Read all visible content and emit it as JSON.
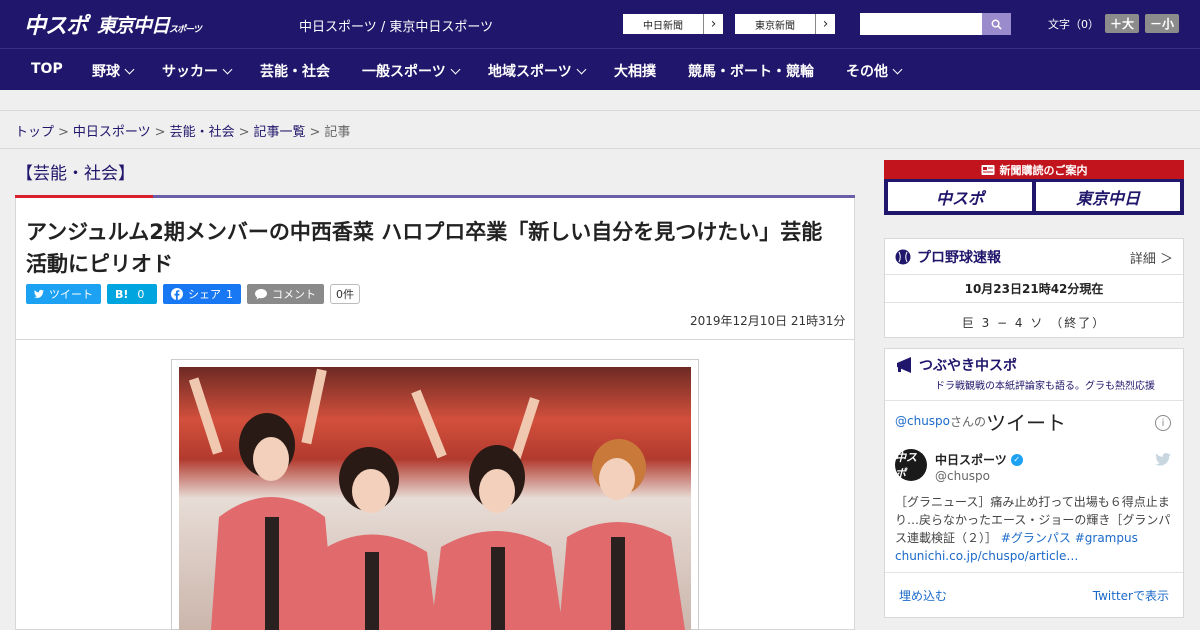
{
  "header": {
    "logo_chuspo": "中スポ",
    "logo_tokyo": "東京中日",
    "logo_tokyo_small": "スポーツ",
    "site_names": "中日スポーツ / 東京中日スポーツ",
    "papers": [
      {
        "label": "中日新聞"
      },
      {
        "label": "東京新聞"
      }
    ],
    "font_size_label": "文字（0）",
    "font_larger": "＋大",
    "font_smaller": "－小"
  },
  "nav": {
    "items": [
      {
        "label": "TOP",
        "has_menu": false
      },
      {
        "label": "野球",
        "has_menu": true
      },
      {
        "label": "サッカー",
        "has_menu": true
      },
      {
        "label": "芸能・社会",
        "has_menu": false
      },
      {
        "label": "一般スポーツ",
        "has_menu": true
      },
      {
        "label": "地域スポーツ",
        "has_menu": true
      },
      {
        "label": "大相撲",
        "has_menu": false
      },
      {
        "label": "競馬・ボート・競輪",
        "has_menu": false
      },
      {
        "label": "その他",
        "has_menu": true
      }
    ]
  },
  "breadcrumb": {
    "items": [
      "トップ",
      "中日スポーツ",
      "芸能・社会",
      "記事一覧"
    ],
    "current": "記事",
    "separator": ">"
  },
  "article": {
    "section": "【芸能・社会】",
    "headline": "アンジュルム2期メンバーの中西香菜 ハロプロ卒業「新しい自分を見つけたい」芸能活動にピリオド",
    "share": {
      "tweet": "ツイート",
      "hatena_icon": "B!",
      "hatena_count": "0",
      "facebook": "シェア",
      "facebook_count": "1",
      "comment": "コメント",
      "comment_count": "0件"
    },
    "date": "2019年12月10日 21時31分"
  },
  "sidebar": {
    "subscribe": {
      "title": "新聞購読のご案内",
      "left": "中スポ",
      "right": "東京中日"
    },
    "baseball": {
      "title": "プロ野球速報",
      "detail": "詳細 ＞",
      "updated": "10月23日21時42分現在",
      "score": "巨 3 − 4 ソ （終了）"
    },
    "tsubuyaki": {
      "title": "つぶやき中スポ",
      "subtitle": "ドラ戦観戦の本紙評論家も語る。グラも熱烈応援",
      "handle": "@chuspo",
      "handle_suffix": "さんの",
      "tweets_word": "ツイート",
      "author_name": "中日スポーツ",
      "author_handle": "@chuspo",
      "avatar_text": "中スポ",
      "tweet_text": "［グラニュース］痛み止め打って出場も６得点止まり…戻らなかったエース・ジョーの輝き［グランパス連載検証（２）］",
      "tweet_tags": "#グランパス #grampus",
      "tweet_link": "chunichi.co.jp/chuspo/article…",
      "embed": "埋め込む",
      "view_twitter": "Twitterで表示"
    }
  },
  "colors": {
    "brand_navy": "#20166b",
    "accent_red": "#d8212a",
    "accent_purple": "#6a5fa8",
    "link_blue": "#1b6ac9"
  }
}
